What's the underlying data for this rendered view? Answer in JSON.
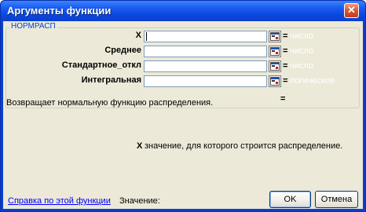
{
  "window": {
    "title": "Аргументы функции",
    "close_glyph": "✕"
  },
  "function": {
    "name": "НОРМРАСП",
    "description": "Возвращает нормальную функцию распределения."
  },
  "arguments": [
    {
      "label": "X",
      "value": "",
      "result_eq": "=",
      "result_hint": "число"
    },
    {
      "label": "Среднее",
      "value": "",
      "result_eq": "=",
      "result_hint": "число"
    },
    {
      "label": "Стандартное_откл",
      "value": "",
      "result_eq": "=",
      "result_hint": "число"
    },
    {
      "label": "Интегральная",
      "value": "",
      "result_eq": "=",
      "result_hint": "логическое"
    }
  ],
  "result_eq": "=",
  "selected_argument": {
    "name": "X",
    "description": "значение, для которого строится распределение."
  },
  "footer": {
    "help_link": "Справка по этой функции",
    "value_label": "Значение:",
    "ok_label": "OK",
    "cancel_label": "Отмена"
  },
  "icons": {
    "collapse": "collapse-dialog-icon"
  },
  "colors": {
    "title_bar": "#0a46de",
    "dialog_bg": "#ece9d8",
    "group_label": "#0046d5",
    "link": "#0000ff"
  }
}
